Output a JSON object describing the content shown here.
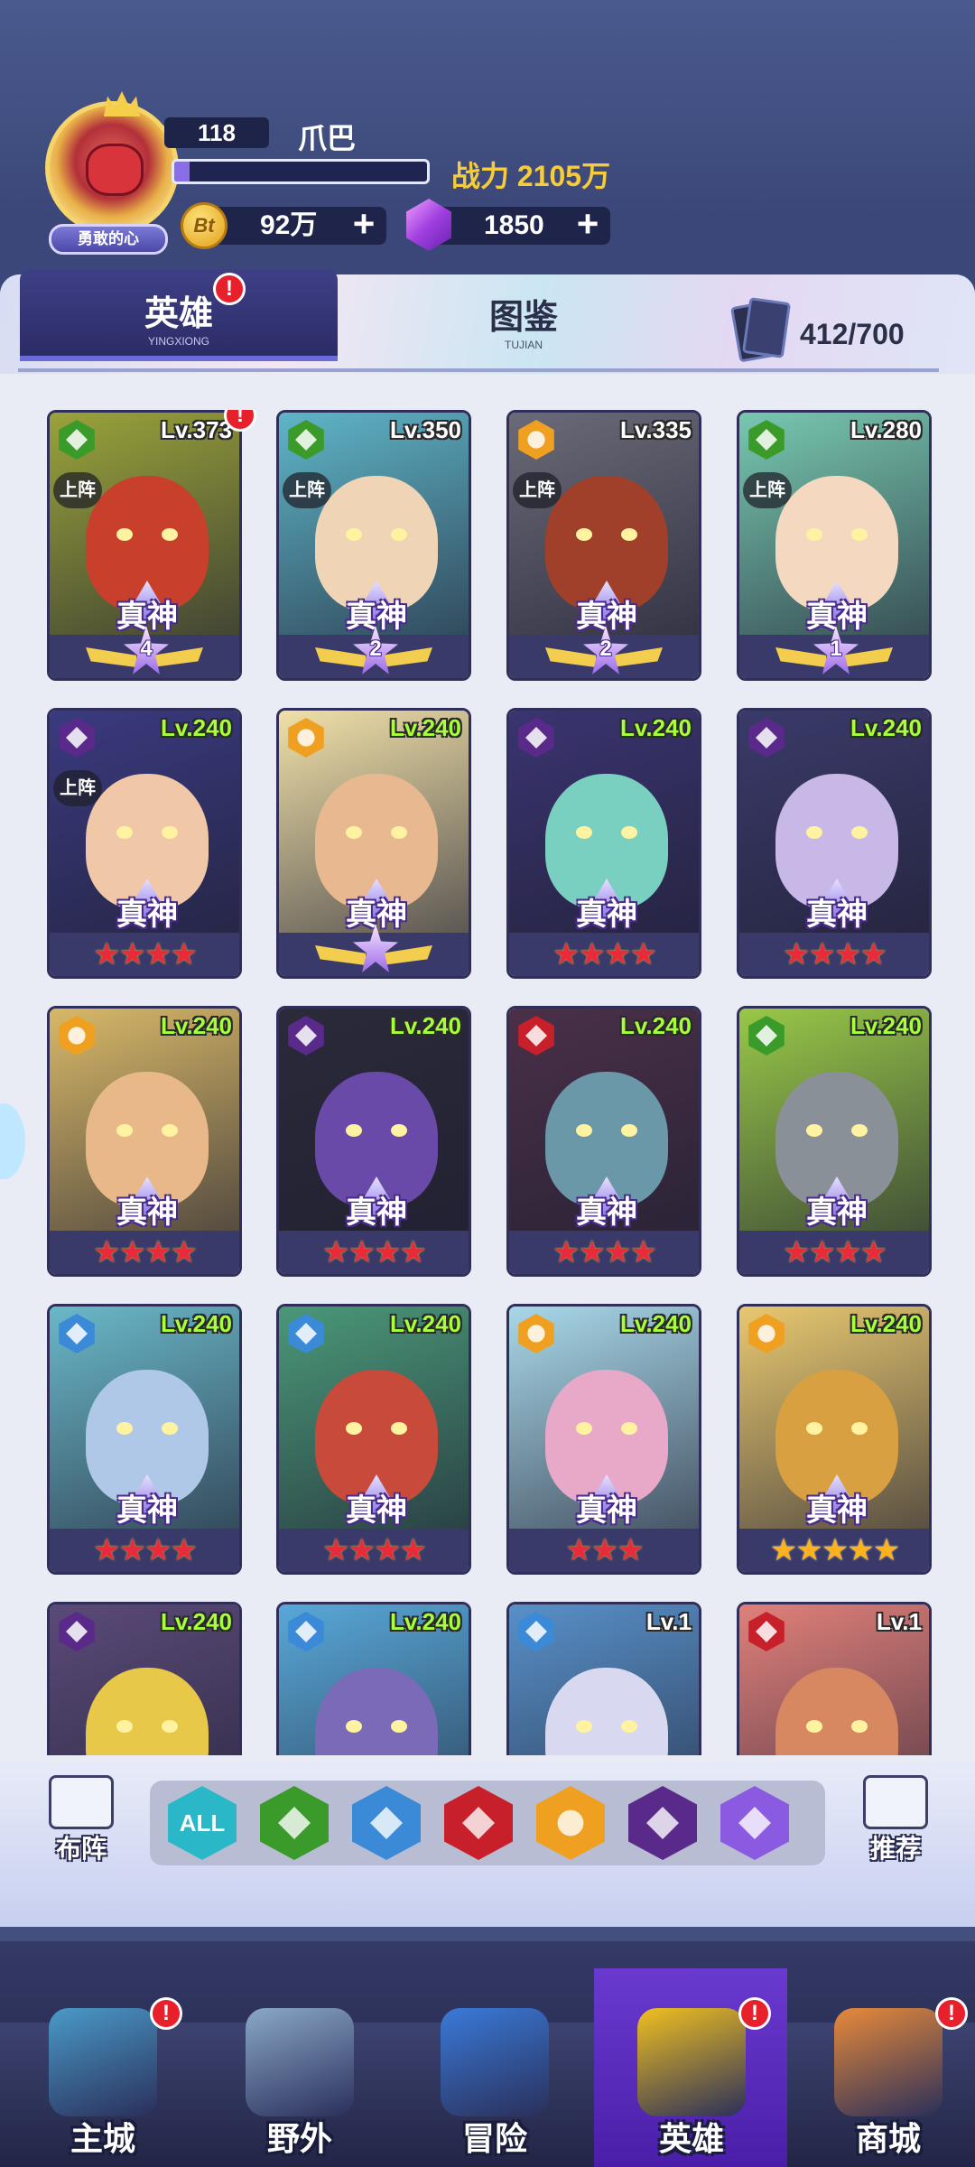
{
  "player": {
    "level": "118",
    "name": "爪巴",
    "title_badge": "勇敢的心",
    "power_label": "战力 2105万",
    "xp_fraction": 0.06
  },
  "resources": {
    "coin": {
      "icon": "coin-icon",
      "glyph": "Bt",
      "value": "92万",
      "add": "+"
    },
    "gem": {
      "icon": "gem-icon",
      "value": "1850",
      "add": "+"
    }
  },
  "tabs": {
    "hero": {
      "label": "英雄",
      "sub": "YINGXIONG",
      "alert": "!"
    },
    "codex": {
      "label": "图鉴",
      "sub": "TUJIAN"
    },
    "collection": "412/700"
  },
  "colors": {
    "accent_purple": "#6a3ad0",
    "power_gold": "#f6cc3c",
    "alert_red": "#e8202c",
    "level_green": "#a6ff3a"
  },
  "heroes": [
    {
      "level": "Lv.373",
      "element": "nature",
      "deployed": "上阵",
      "rank": "真神",
      "wings": "4",
      "alert": "!",
      "bg": "#9aa33a",
      "skin": "#c8402c"
    },
    {
      "level": "Lv.350",
      "element": "nature",
      "deployed": "上阵",
      "rank": "真神",
      "wings": "2",
      "bg": "#5fb5c8",
      "skin": "#f0d4b6"
    },
    {
      "level": "Lv.335",
      "element": "light",
      "deployed": "上阵",
      "rank": "真神",
      "wings": "2",
      "bg": "#6a6a78",
      "skin": "#a0402a"
    },
    {
      "level": "Lv.280",
      "element": "nature",
      "deployed": "上阵",
      "rank": "真神",
      "wings": "1",
      "bg": "#78c8b0",
      "skin": "#f4d8c0"
    },
    {
      "level": "Lv.240",
      "element": "void",
      "deployed": "上阵",
      "rank": "真神",
      "stars": "★★★★",
      "star_color": "red",
      "bg": "#3a3a80",
      "skin": "#f0c8a8"
    },
    {
      "level": "Lv.240",
      "element": "light",
      "rank": "真神",
      "wings": "",
      "bg": "#f0e0a8",
      "skin": "#e8b890"
    },
    {
      "level": "Lv.240",
      "element": "void",
      "rank": "真神",
      "stars": "★★★★",
      "star_color": "red",
      "bg": "#3a3470",
      "skin": "#7ad0c0"
    },
    {
      "level": "Lv.240",
      "element": "void",
      "rank": "真神",
      "stars": "★★★★",
      "star_color": "red",
      "bg": "#3a3a6a",
      "skin": "#c8b8e8"
    },
    {
      "level": "Lv.240",
      "element": "light",
      "rank": "真神",
      "stars": "★★★★",
      "star_color": "red",
      "bg": "#d8b868",
      "skin": "#e8b888"
    },
    {
      "level": "Lv.240",
      "element": "void",
      "rank": "真神",
      "stars": "★★★★",
      "star_color": "red",
      "bg": "#2a2a3a",
      "skin": "#6a4aa8"
    },
    {
      "level": "Lv.240",
      "element": "fury",
      "rank": "真神",
      "stars": "★★★★",
      "star_color": "red",
      "bg": "#4a3048",
      "skin": "#6a98a8"
    },
    {
      "level": "Lv.240",
      "element": "nature",
      "rank": "真神",
      "stars": "★★★★",
      "star_color": "red",
      "bg": "#98c848",
      "skin": "#8a9098"
    },
    {
      "level": "Lv.240",
      "element": "water",
      "rank": "真神",
      "stars": "★★★★",
      "star_color": "red",
      "bg": "#6ab8c8",
      "skin": "#b0c8e8"
    },
    {
      "level": "Lv.240",
      "element": "water",
      "rank": "真神",
      "stars": "★★★★",
      "star_color": "red",
      "bg": "#4a9878",
      "skin": "#c84a3a"
    },
    {
      "level": "Lv.240",
      "element": "light",
      "rank": "真神",
      "stars": "★★★",
      "star_color": "red",
      "bg": "#a8d8e8",
      "skin": "#e8a8c8"
    },
    {
      "level": "Lv.240",
      "element": "light",
      "rank": "真神",
      "stars": "★★★★★",
      "star_color": "gold",
      "bg": "#e8c870",
      "skin": "#d8a040"
    },
    {
      "level": "Lv.240",
      "element": "void",
      "bg": "#5a4a78",
      "skin": "#e8c848"
    },
    {
      "level": "Lv.240",
      "element": "water",
      "bg": "#58a8d8",
      "skin": "#7a6ab8"
    },
    {
      "level": "Lv.1",
      "element": "water",
      "bg": "#5890c8",
      "skin": "#d8d8f0"
    },
    {
      "level": "Lv.1",
      "element": "fury",
      "bg": "#e0807a",
      "skin": "#d88860"
    }
  ],
  "filters": [
    {
      "name": "filter-all",
      "label": "ALL",
      "color": "#2ab8c8"
    },
    {
      "name": "filter-nature",
      "label": "",
      "color": "#3a9a2a"
    },
    {
      "name": "filter-water",
      "label": "",
      "color": "#3a8ad8"
    },
    {
      "name": "filter-fury",
      "label": "",
      "color": "#c8202a"
    },
    {
      "name": "filter-light",
      "label": "",
      "color": "#f0a020"
    },
    {
      "name": "filter-void",
      "label": "",
      "color": "#5a2a8a"
    },
    {
      "name": "filter-arcane",
      "label": "",
      "color": "#8a5ae0"
    }
  ],
  "side_buttons": {
    "formation": "布阵",
    "recommend": "推荐"
  },
  "nav": [
    {
      "label": "主城",
      "icon": "city-icon",
      "alert": "!"
    },
    {
      "label": "野外",
      "icon": "field-icon"
    },
    {
      "label": "冒险",
      "icon": "adventure-icon"
    },
    {
      "label": "英雄",
      "icon": "hero-icon",
      "alert": "!",
      "active": true
    },
    {
      "label": "商城",
      "icon": "shop-icon",
      "alert": "!"
    }
  ]
}
